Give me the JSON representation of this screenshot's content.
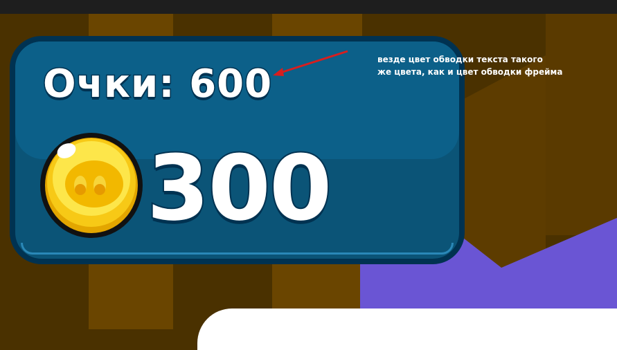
{
  "hud": {
    "score_label": "Очки: 600",
    "coin_count": "300",
    "coin_icon": "pig-coin-icon"
  },
  "annotation": {
    "line1": "везде цвет обводки текста такого",
    "line2": "же цвета, как и цвет обводки фрейма"
  },
  "colors": {
    "frame_fill": "#0b5477",
    "frame_top_fill": "#0c6089",
    "frame_stroke": "#003251",
    "text_fill": "#ffffff",
    "coin_gold": "#f5c400",
    "arrow": "#d81e1e",
    "background": "#4a3100",
    "purple_terrain": "#6a55d4"
  }
}
